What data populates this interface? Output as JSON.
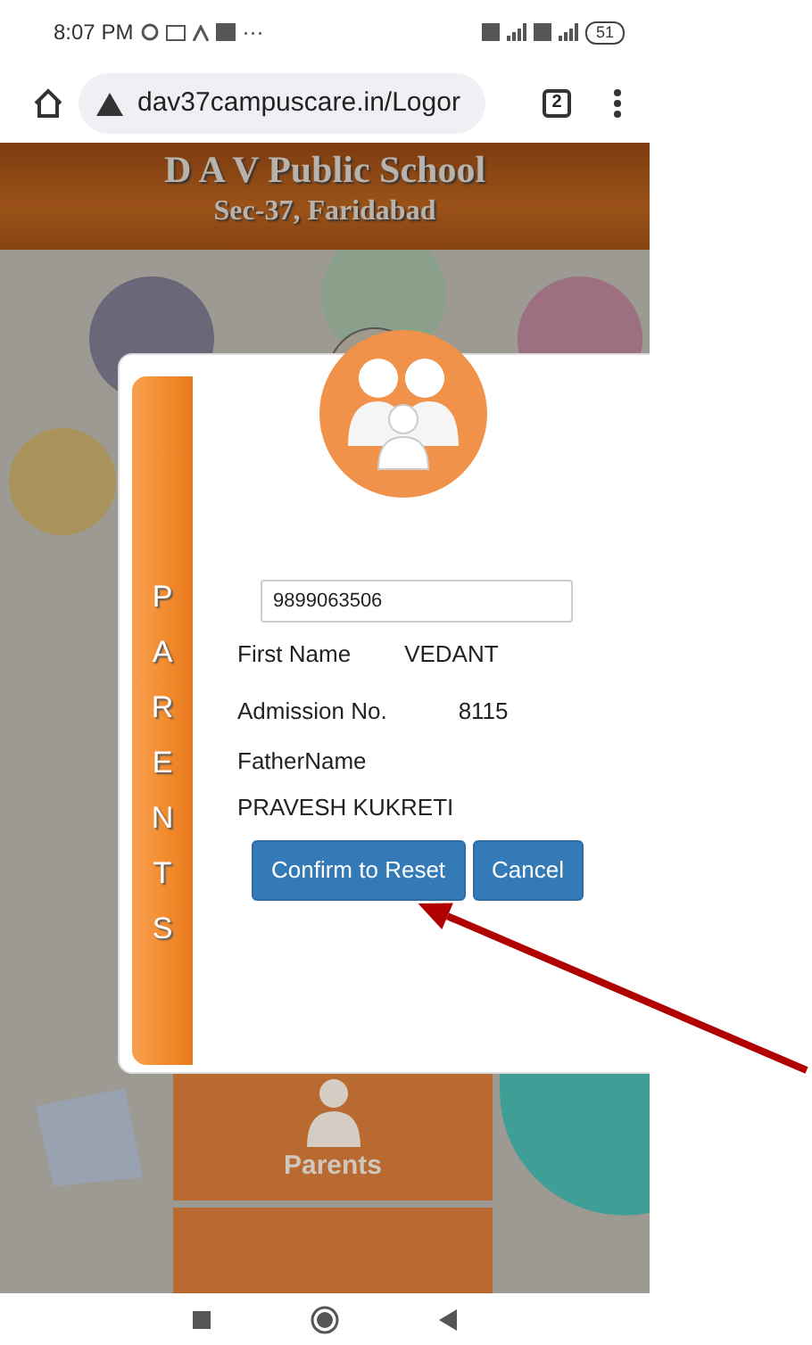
{
  "status_bar": {
    "time": "8:07 PM",
    "more": "···",
    "battery": "51"
  },
  "browser": {
    "url": "dav37campuscare.in/Logor",
    "tab_count": "2"
  },
  "site_header": {
    "title": "D A V Public School",
    "subtitle": "Sec-37, Faridabad"
  },
  "background_tiles": [
    {
      "label": "Parents"
    }
  ],
  "dialog": {
    "side_label": "PARENTS",
    "mobile": "9899063506",
    "fields": [
      {
        "label": "First Name",
        "value": "VEDANT"
      },
      {
        "label": "Admission No.",
        "value": "8115"
      }
    ],
    "father_label": "FatherName",
    "father_value": "PRAVESH KUKRETI",
    "buttons": [
      {
        "label": "Confirm to Reset"
      },
      {
        "label": "Cancel"
      }
    ]
  }
}
